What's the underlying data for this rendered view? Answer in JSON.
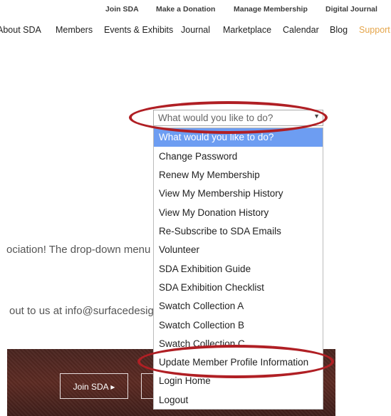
{
  "utility_nav": [
    "Join SDA",
    "Make a Donation",
    "Manage Membership",
    "Digital Journal"
  ],
  "main_nav": [
    "About SDA",
    "Members",
    "Events & Exhibits",
    "Journal",
    "Marketplace",
    "Calendar",
    "Blog",
    "Support"
  ],
  "body": {
    "line1": "ociation! The drop-down menu",
    "line2": "out to us at info@surfacedesign.org"
  },
  "banner": {
    "join_label": "Join SDA  ▸"
  },
  "select": {
    "value": "What would you like to do?",
    "options": [
      "What would you like to do?",
      "Change Password",
      "Renew My Membership",
      "View My Membership History",
      "View My Donation History",
      "Re-Subscribe to SDA Emails",
      "Volunteer",
      "SDA Exhibition Guide",
      "SDA Exhibition Checklist",
      "Swatch Collection A",
      "Swatch Collection B",
      "Swatch Collection C",
      "Update Member Profile Information",
      "Login Home",
      "Logout"
    ]
  },
  "colors": {
    "highlight_oval": "#b01f24",
    "selected_option": "#6d9df2",
    "accent_nav": "#e5a54a"
  }
}
